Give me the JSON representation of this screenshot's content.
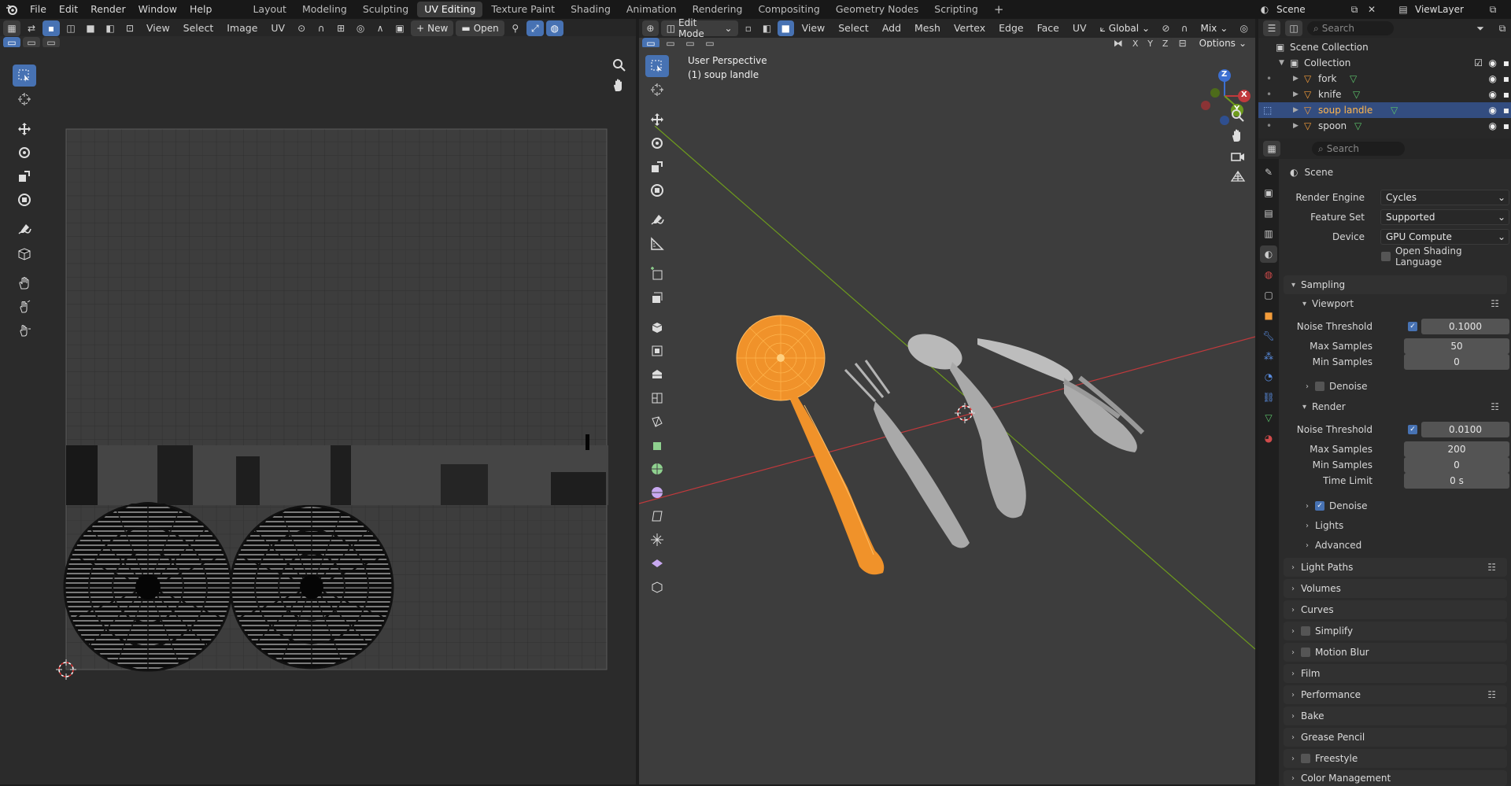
{
  "topbar": {
    "menus": [
      "File",
      "Edit",
      "Render",
      "Window",
      "Help"
    ],
    "workspaces": [
      "Layout",
      "Modeling",
      "Sculpting",
      "UV Editing",
      "Texture Paint",
      "Shading",
      "Animation",
      "Rendering",
      "Compositing",
      "Geometry Nodes",
      "Scripting"
    ],
    "active_workspace": "UV Editing",
    "add_tab": "+",
    "scene": "Scene",
    "view_layer": "ViewLayer"
  },
  "uv_editor": {
    "menus": [
      "View",
      "Select",
      "Image",
      "UV"
    ],
    "new_label": "New",
    "open_label": "Open"
  },
  "viewport": {
    "mode": "Edit Mode",
    "menus": [
      "View",
      "Select",
      "Add",
      "Mesh",
      "Vertex",
      "Edge",
      "Face",
      "UV"
    ],
    "orientation": "Global",
    "shading_mix": "Mix",
    "options_label": "Options",
    "axes": [
      "X",
      "Y",
      "Z"
    ],
    "overlay_line1": "User Perspective",
    "overlay_line2": "(1) soup landle",
    "gizmo": {
      "x": "X",
      "y": "Y",
      "z": "Z"
    }
  },
  "outliner": {
    "search_placeholder": "Search",
    "scene_collection": "Scene Collection",
    "collection": "Collection",
    "items": [
      {
        "name": "fork",
        "selected": false
      },
      {
        "name": "knife",
        "selected": false
      },
      {
        "name": "soup landle",
        "selected": true
      },
      {
        "name": "spoon",
        "selected": false
      }
    ]
  },
  "properties": {
    "search_placeholder": "Search",
    "context": "Scene",
    "render_engine_label": "Render Engine",
    "render_engine": "Cycles",
    "feature_set_label": "Feature Set",
    "feature_set": "Supported",
    "device_label": "Device",
    "device": "GPU Compute",
    "osl_label": "Open Shading Language",
    "sampling": "Sampling",
    "viewport": "Viewport",
    "noise_threshold_label": "Noise Threshold",
    "vp_noise_threshold": "0.1000",
    "max_samples_label": "Max Samples",
    "vp_max_samples": "50",
    "min_samples_label": "Min Samples",
    "vp_min_samples": "0",
    "denoise_label": "Denoise",
    "render": "Render",
    "r_noise_threshold": "0.0100",
    "r_max_samples": "200",
    "r_min_samples": "0",
    "time_limit_label": "Time Limit",
    "r_time_limit": "0 s",
    "lights": "Lights",
    "advanced": "Advanced",
    "panels": [
      "Light Paths",
      "Volumes",
      "Curves",
      "Simplify",
      "Motion Blur",
      "Film",
      "Performance",
      "Bake",
      "Grease Pencil",
      "Freestyle",
      "Color Management"
    ]
  },
  "colors": {
    "accent": "#4772b3",
    "selection": "#ff9a1f",
    "x_axis": "#c0393c",
    "y_axis": "#6e9b1d",
    "z_axis": "#3c6fd1"
  }
}
